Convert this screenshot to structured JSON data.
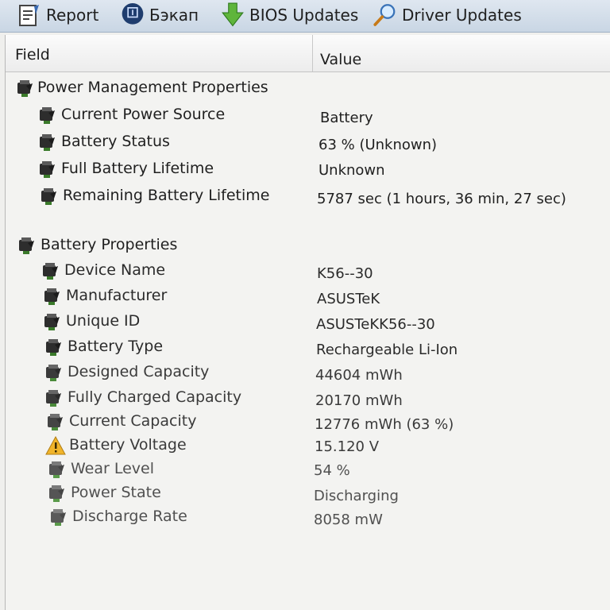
{
  "toolbar": {
    "buttons": [
      {
        "label": "Report",
        "icon": "report-icon"
      },
      {
        "label": "Бэкап",
        "icon": "backup-icon"
      },
      {
        "label": "BIOS Updates",
        "icon": "download-arrow-icon"
      },
      {
        "label": "Driver Updates",
        "icon": "magnifier-icon"
      }
    ]
  },
  "table": {
    "columns": {
      "field": "Field",
      "value": "Value"
    },
    "groups": [
      {
        "title": "Power Management Properties",
        "rows": [
          {
            "field": "Current Power Source",
            "value": "Battery"
          },
          {
            "field": "Battery Status",
            "value": "63 % (Unknown)"
          },
          {
            "field": "Full Battery Lifetime",
            "value": "Unknown"
          },
          {
            "field": "Remaining Battery Lifetime",
            "value": "5787 sec (1 hours, 36 min, 27 sec)"
          }
        ]
      },
      {
        "title": "Battery Properties",
        "rows": [
          {
            "field": "Device Name",
            "value": "K56--30"
          },
          {
            "field": "Manufacturer",
            "value": "ASUSTeK"
          },
          {
            "field": "Unique ID",
            "value": "ASUSTeKK56--30"
          },
          {
            "field": "Battery Type",
            "value": "Rechargeable Li-Ion"
          },
          {
            "field": "Designed Capacity",
            "value": "44604 mWh"
          },
          {
            "field": "Fully Charged Capacity",
            "value": "20170 mWh"
          },
          {
            "field": "Current Capacity",
            "value": "12776 mWh  (63 %)"
          },
          {
            "field": "Battery Voltage",
            "value": "15.120 V",
            "icon": "warning-icon"
          },
          {
            "field": "Wear Level",
            "value": "54 %"
          },
          {
            "field": "Power State",
            "value": "Discharging"
          },
          {
            "field": "Discharge Rate",
            "value": "8058 mW"
          }
        ]
      }
    ]
  }
}
